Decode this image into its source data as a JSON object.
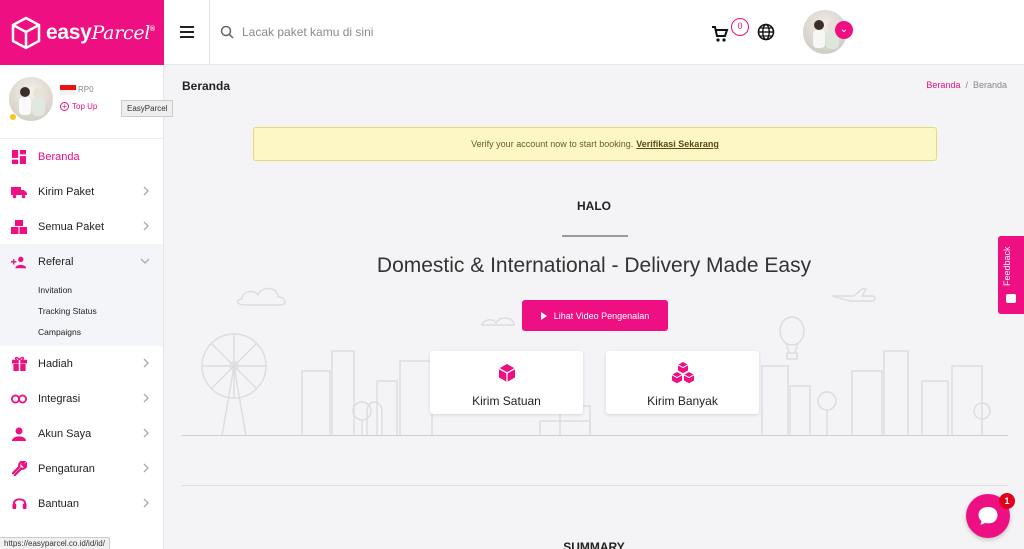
{
  "brand": {
    "name": "easy",
    "script": "Parcel",
    "mark": "®"
  },
  "topbar": {
    "search_placeholder": "Lacak paket kamu di sini",
    "cart_count": "0"
  },
  "profile": {
    "balance": "RP0",
    "topup_label": "Top Up",
    "tooltip": "EasyParcel"
  },
  "sidebar": {
    "items": [
      {
        "label": "Beranda",
        "icon": "dashboard-icon",
        "active": true
      },
      {
        "label": "Kirim Paket",
        "icon": "truck-icon"
      },
      {
        "label": "Semua Paket",
        "icon": "boxes-icon"
      },
      {
        "label": "Referal",
        "icon": "referral-icon",
        "expanded": true
      },
      {
        "label": "Hadiah",
        "icon": "gift-icon"
      },
      {
        "label": "Integrasi",
        "icon": "link-icon"
      },
      {
        "label": "Akun Saya",
        "icon": "user-icon"
      },
      {
        "label": "Pengaturan",
        "icon": "wrench-icon"
      },
      {
        "label": "Bantuan",
        "icon": "headset-icon"
      }
    ],
    "referral_sub": [
      "Invitation",
      "Tracking Status",
      "Campaigns"
    ]
  },
  "main": {
    "title": "Beranda",
    "breadcrumb": [
      "Beranda",
      "/",
      "Beranda"
    ],
    "alert_text": "Verify your account now to start booking.",
    "alert_link": "Verifikasi Sekarang",
    "halo": "HALO",
    "headline": "Domestic & International - Delivery Made Easy",
    "video_button": "Lihat Video Pengenalan",
    "cards": [
      "Kirim Satuan",
      "Kirim Banyak"
    ],
    "summary": "SUMMARY"
  },
  "feedback_label": "Feedback",
  "chat_badge": "1",
  "status_url": "https://easyparcel.co.id/id/id/",
  "colors": {
    "accent": "#ee0f82",
    "alert_bg": "#fdf6c5"
  }
}
